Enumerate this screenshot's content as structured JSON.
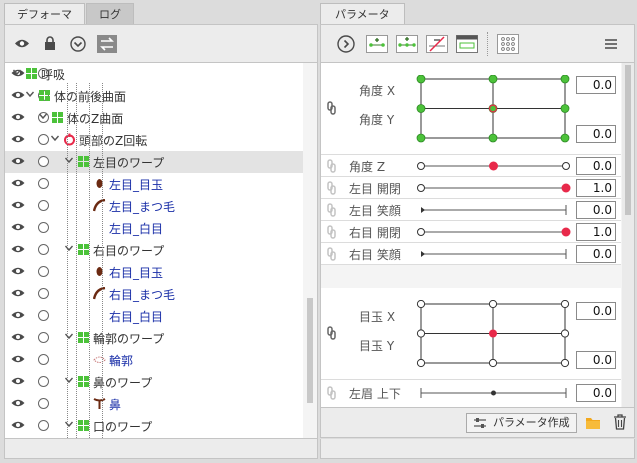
{
  "left_panel": {
    "tabs": [
      {
        "label": "デフォーマ"
      },
      {
        "label": "ログ"
      }
    ]
  },
  "tree": {
    "rows": [
      {
        "label": "呼吸",
        "type": "warp"
      },
      {
        "label": "体の前後曲面",
        "type": "warp"
      },
      {
        "label": "体のZ曲面",
        "type": "warp"
      },
      {
        "label": "頭部のZ回転",
        "type": "rotation"
      },
      {
        "label": "左目のワープ",
        "type": "warp",
        "selected": true
      },
      {
        "label": "左目_目玉",
        "type": "artmesh"
      },
      {
        "label": "左目_まつ毛",
        "type": "artmesh"
      },
      {
        "label": "左目_白目",
        "type": "artmesh"
      },
      {
        "label": "右目のワープ",
        "type": "warp"
      },
      {
        "label": "右目_目玉",
        "type": "artmesh"
      },
      {
        "label": "右目_まつ毛",
        "type": "artmesh"
      },
      {
        "label": "右目_白目",
        "type": "artmesh"
      },
      {
        "label": "輪郭のワープ",
        "type": "warp"
      },
      {
        "label": "輪郭",
        "type": "artmesh"
      },
      {
        "label": "鼻のワープ",
        "type": "warp"
      },
      {
        "label": "鼻",
        "type": "artmesh"
      },
      {
        "label": "口のワープ",
        "type": "warp"
      }
    ]
  },
  "right_panel": {
    "tab": "パラメータ",
    "params": {
      "angle_xy": {
        "label_x": "角度 X",
        "label_y": "角度 Y",
        "value_top": "0.0",
        "value_bottom": "0.0"
      },
      "angle_z": {
        "label": "角度 Z",
        "value": "0.0",
        "position": 0.5
      },
      "left_eye_open": {
        "label": "左目 開閉",
        "value": "1.0",
        "position": 1.0
      },
      "left_eye_smile": {
        "label": "左目 笑顔",
        "value": "0.0",
        "position": 0.0
      },
      "right_eye_open": {
        "label": "右目 開閉",
        "value": "1.0",
        "position": 1.0
      },
      "right_eye_smile": {
        "label": "右目 笑顔",
        "value": "0.0",
        "position": 0.0
      },
      "eyeball_xy": {
        "label_x": "目玉 X",
        "label_y": "目玉 Y",
        "value_top": "0.0",
        "value_bottom": "0.0"
      },
      "left_brow": {
        "label": "左眉 上下",
        "value": "0.0",
        "position": 0.5
      }
    },
    "create_button": "パラメータ作成"
  },
  "colors": {
    "accent_red": "#e8294a",
    "green_point": "#4cc23a",
    "artmesh_text": "#1a2fa8"
  }
}
